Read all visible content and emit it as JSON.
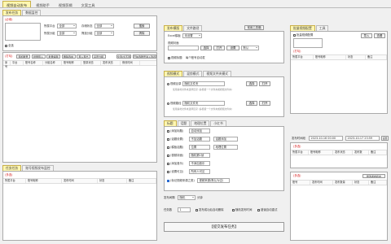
{
  "main_tabs": [
    "视频自动发布",
    "视频助手",
    "视频剪辑",
    "文案工具"
  ],
  "sub_tabs": [
    "发布任务",
    "数据监控"
  ],
  "left": {
    "filter": {
      "title_tag": "(必填)",
      "platform_label": "所属平台",
      "platform_value": "全部",
      "group_label": "所属分组",
      "group_value": "全部",
      "status_label": "存储状态",
      "status_value": "全部",
      "filter_label": "筛选分组",
      "filter_value": "全部",
      "search_btn": "搜索",
      "reset_btn": "清除",
      "checkbox_label": "全选"
    },
    "list_tag": "(打勾)",
    "toolbar": [
      "添加账号",
      "批量导入",
      "批量编辑",
      "删除选中",
      "导入导出",
      "设置分组"
    ],
    "toolbar_right": [
      "全选/全不选",
      "已勾选账号进入列表"
    ],
    "columns": [
      "序号",
      "平台",
      "账号名称",
      "分组名称",
      "账号昵称",
      "登录状态",
      "发布状态",
      "修改时间"
    ],
    "bottom_tabs": [
      "任务任务",
      "账号视频发布监控"
    ],
    "bottom_tag": "(多选)",
    "bottom_columns": [
      "所属平台",
      "账号昵称",
      "发布时间",
      "状态",
      "备注"
    ]
  },
  "mid": {
    "tabs": [
      "发布模版",
      "文件路径"
    ],
    "template_btn": "常用工具箱",
    "excel_label": "Excel模板",
    "excel_value": "未设置",
    "cover_label": "视频封面",
    "cover_value": "",
    "select_btn": "选择",
    "open_btn": "打开",
    "settings_label": "设置",
    "default_value": "默认",
    "auto_check": "视频标题",
    "auto_check2": "每个账号自动发",
    "section2_tabs": [
      "视频模式",
      "混剪模式",
      "视频文件夹模式"
    ],
    "video_folder_label": "视频目录",
    "video_folder_value": "随机文件夹",
    "video_note": "使用素材文件夹选择目录 (多视频一个文件夹或视频文件夹)",
    "file_label": "视频路径",
    "file_value": "随机文件夹",
    "file_note": "使用素材文件夹选择目录 (多视频一个文件夹或视频文件夹)",
    "section3_tabs": [
      "标题",
      "话题",
      "地理位置",
      "小红书"
    ],
    "rows": [
      {
        "label": "(添加标题)",
        "value": "自动添加"
      },
      {
        "label": "(话题设置)",
        "value": "不加话题",
        "value2": "话题添加"
      },
      {
        "label": "(模板话题)",
        "value": "位置",
        "value2": "地理位置"
      },
      {
        "label": "(视频封面)",
        "value": "随机第1帧"
      },
      {
        "label": "(添加音乐)",
        "value": "不添加音乐"
      },
      {
        "label": "(设置可见)",
        "value": "所有人可见"
      }
    ],
    "row_last_label": "(标记视频来源之类)",
    "row_last_value": "视频来源(默认为空)",
    "count_label": "发布间隔",
    "count_value": "分钟",
    "count2_label": "任务数",
    "count2_value": "1",
    "checks": [
      "发布成功后自动删除",
      "随机发布时间",
      "错误自动重试"
    ],
    "submit_btn": "【提交发布任务】",
    "interval_value": "随机"
  },
  "right": {
    "tabs": [
      "批量视频配置",
      "工具"
    ],
    "auto_check": "批量视频配置",
    "btn_a": "导入",
    "btn_b": "查看",
    "tag": "(打勾)",
    "columns": [
      "所属平台",
      "账号昵称",
      "状态",
      "备注"
    ],
    "range_label": "发布时间段",
    "date_from": "2023-10-16 00:00",
    "date_to": "2023-10-17 23:59",
    "range_btn": "设置",
    "mid_tag": "(多选)",
    "mid_columns": [
      "所属平台",
      "账号昵称",
      "发布状态",
      "发布数",
      "备注"
    ],
    "bottom_tag": "(多选)",
    "bottom_btn": "修改发布状态",
    "bottom_columns": [
      "账号",
      "发布时间",
      "发布数量",
      "状态",
      "备注"
    ]
  }
}
